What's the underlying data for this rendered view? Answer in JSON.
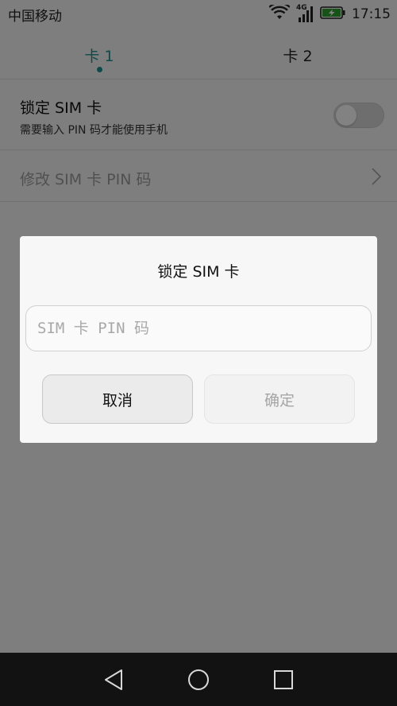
{
  "status_bar": {
    "carrier": "中国移动",
    "network_type": "4G",
    "time": "17:15",
    "battery_color": "#2e9e2e"
  },
  "tabs": [
    {
      "label": "卡 1",
      "active": true
    },
    {
      "label": "卡 2",
      "active": false
    }
  ],
  "settings": {
    "lock_sim": {
      "title": "锁定 SIM 卡",
      "subtitle": "需要输入 PIN 码才能使用手机",
      "enabled": false
    },
    "change_pin": {
      "title": "修改 SIM 卡 PIN 码"
    }
  },
  "dialog": {
    "title": "锁定 SIM 卡",
    "input_placeholder": "SIM 卡 PIN 码",
    "input_value": "",
    "cancel_label": "取消",
    "confirm_label": "确定"
  },
  "nav_bar": {
    "icons": [
      "back-icon",
      "home-icon",
      "recents-icon"
    ]
  },
  "colors": {
    "accent": "#1e8c8c"
  }
}
